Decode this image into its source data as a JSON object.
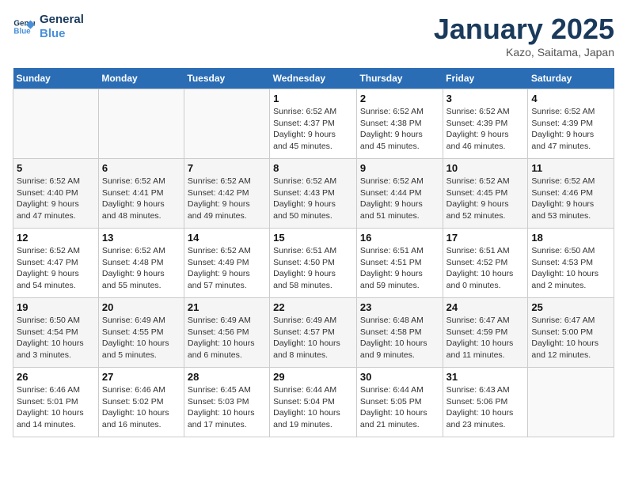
{
  "header": {
    "logo_line1": "General",
    "logo_line2": "Blue",
    "title": "January 2025",
    "subtitle": "Kazo, Saitama, Japan"
  },
  "days_of_week": [
    "Sunday",
    "Monday",
    "Tuesday",
    "Wednesday",
    "Thursday",
    "Friday",
    "Saturday"
  ],
  "weeks": [
    [
      {
        "day": "",
        "info": ""
      },
      {
        "day": "",
        "info": ""
      },
      {
        "day": "",
        "info": ""
      },
      {
        "day": "1",
        "info": "Sunrise: 6:52 AM\nSunset: 4:37 PM\nDaylight: 9 hours\nand 45 minutes."
      },
      {
        "day": "2",
        "info": "Sunrise: 6:52 AM\nSunset: 4:38 PM\nDaylight: 9 hours\nand 45 minutes."
      },
      {
        "day": "3",
        "info": "Sunrise: 6:52 AM\nSunset: 4:39 PM\nDaylight: 9 hours\nand 46 minutes."
      },
      {
        "day": "4",
        "info": "Sunrise: 6:52 AM\nSunset: 4:39 PM\nDaylight: 9 hours\nand 47 minutes."
      }
    ],
    [
      {
        "day": "5",
        "info": "Sunrise: 6:52 AM\nSunset: 4:40 PM\nDaylight: 9 hours\nand 47 minutes."
      },
      {
        "day": "6",
        "info": "Sunrise: 6:52 AM\nSunset: 4:41 PM\nDaylight: 9 hours\nand 48 minutes."
      },
      {
        "day": "7",
        "info": "Sunrise: 6:52 AM\nSunset: 4:42 PM\nDaylight: 9 hours\nand 49 minutes."
      },
      {
        "day": "8",
        "info": "Sunrise: 6:52 AM\nSunset: 4:43 PM\nDaylight: 9 hours\nand 50 minutes."
      },
      {
        "day": "9",
        "info": "Sunrise: 6:52 AM\nSunset: 4:44 PM\nDaylight: 9 hours\nand 51 minutes."
      },
      {
        "day": "10",
        "info": "Sunrise: 6:52 AM\nSunset: 4:45 PM\nDaylight: 9 hours\nand 52 minutes."
      },
      {
        "day": "11",
        "info": "Sunrise: 6:52 AM\nSunset: 4:46 PM\nDaylight: 9 hours\nand 53 minutes."
      }
    ],
    [
      {
        "day": "12",
        "info": "Sunrise: 6:52 AM\nSunset: 4:47 PM\nDaylight: 9 hours\nand 54 minutes."
      },
      {
        "day": "13",
        "info": "Sunrise: 6:52 AM\nSunset: 4:48 PM\nDaylight: 9 hours\nand 55 minutes."
      },
      {
        "day": "14",
        "info": "Sunrise: 6:52 AM\nSunset: 4:49 PM\nDaylight: 9 hours\nand 57 minutes."
      },
      {
        "day": "15",
        "info": "Sunrise: 6:51 AM\nSunset: 4:50 PM\nDaylight: 9 hours\nand 58 minutes."
      },
      {
        "day": "16",
        "info": "Sunrise: 6:51 AM\nSunset: 4:51 PM\nDaylight: 9 hours\nand 59 minutes."
      },
      {
        "day": "17",
        "info": "Sunrise: 6:51 AM\nSunset: 4:52 PM\nDaylight: 10 hours\nand 0 minutes."
      },
      {
        "day": "18",
        "info": "Sunrise: 6:50 AM\nSunset: 4:53 PM\nDaylight: 10 hours\nand 2 minutes."
      }
    ],
    [
      {
        "day": "19",
        "info": "Sunrise: 6:50 AM\nSunset: 4:54 PM\nDaylight: 10 hours\nand 3 minutes."
      },
      {
        "day": "20",
        "info": "Sunrise: 6:49 AM\nSunset: 4:55 PM\nDaylight: 10 hours\nand 5 minutes."
      },
      {
        "day": "21",
        "info": "Sunrise: 6:49 AM\nSunset: 4:56 PM\nDaylight: 10 hours\nand 6 minutes."
      },
      {
        "day": "22",
        "info": "Sunrise: 6:49 AM\nSunset: 4:57 PM\nDaylight: 10 hours\nand 8 minutes."
      },
      {
        "day": "23",
        "info": "Sunrise: 6:48 AM\nSunset: 4:58 PM\nDaylight: 10 hours\nand 9 minutes."
      },
      {
        "day": "24",
        "info": "Sunrise: 6:47 AM\nSunset: 4:59 PM\nDaylight: 10 hours\nand 11 minutes."
      },
      {
        "day": "25",
        "info": "Sunrise: 6:47 AM\nSunset: 5:00 PM\nDaylight: 10 hours\nand 12 minutes."
      }
    ],
    [
      {
        "day": "26",
        "info": "Sunrise: 6:46 AM\nSunset: 5:01 PM\nDaylight: 10 hours\nand 14 minutes."
      },
      {
        "day": "27",
        "info": "Sunrise: 6:46 AM\nSunset: 5:02 PM\nDaylight: 10 hours\nand 16 minutes."
      },
      {
        "day": "28",
        "info": "Sunrise: 6:45 AM\nSunset: 5:03 PM\nDaylight: 10 hours\nand 17 minutes."
      },
      {
        "day": "29",
        "info": "Sunrise: 6:44 AM\nSunset: 5:04 PM\nDaylight: 10 hours\nand 19 minutes."
      },
      {
        "day": "30",
        "info": "Sunrise: 6:44 AM\nSunset: 5:05 PM\nDaylight: 10 hours\nand 21 minutes."
      },
      {
        "day": "31",
        "info": "Sunrise: 6:43 AM\nSunset: 5:06 PM\nDaylight: 10 hours\nand 23 minutes."
      },
      {
        "day": "",
        "info": ""
      }
    ]
  ]
}
